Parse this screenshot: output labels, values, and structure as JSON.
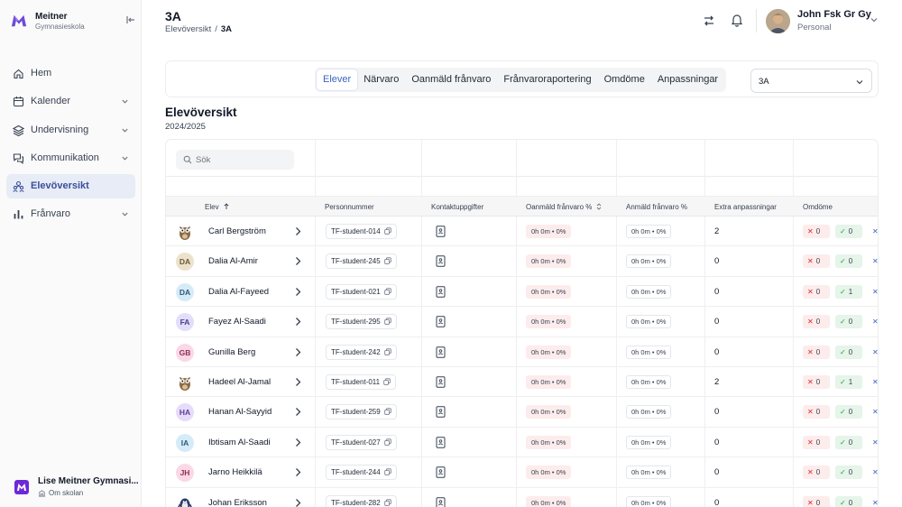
{
  "brand": {
    "name": "Meitner",
    "sub": "Gymnasieskola"
  },
  "nav": [
    {
      "label": "Hem",
      "icon": "home-icon",
      "has_chevron": false,
      "active": false
    },
    {
      "label": "Kalender",
      "icon": "calendar-icon",
      "has_chevron": true,
      "active": false
    },
    {
      "label": "Undervisning",
      "icon": "layers-icon",
      "has_chevron": true,
      "active": false
    },
    {
      "label": "Kommunikation",
      "icon": "chat-icon",
      "has_chevron": true,
      "active": false
    },
    {
      "label": "Elevöversikt",
      "icon": "students-icon",
      "has_chevron": false,
      "active": true
    },
    {
      "label": "Frånvaro",
      "icon": "bar-chart-icon",
      "has_chevron": true,
      "active": false
    }
  ],
  "school": {
    "name": "Lise Meitner Gymnasi...",
    "link": "Om skolan"
  },
  "header": {
    "title": "3A",
    "breadcrumb": [
      "Elevöversikt",
      "3A"
    ],
    "breadcrumb_sep": "/",
    "user_name": "John Fsk Gr Gy",
    "user_role": "Personal"
  },
  "tabs": [
    {
      "label": "Elever",
      "active": true
    },
    {
      "label": "Närvaro",
      "active": false
    },
    {
      "label": "Oanmäld frånvaro",
      "active": false
    },
    {
      "label": "Frånvaroraportering",
      "active": false
    },
    {
      "label": "Omdöme",
      "active": false
    },
    {
      "label": "Anpassningar",
      "active": false
    }
  ],
  "class_select": {
    "value": "3A"
  },
  "section": {
    "title": "Elevöversikt",
    "subtitle": "2024/2025"
  },
  "search": {
    "placeholder": "Sök"
  },
  "columns": {
    "elev": "Elev",
    "personnummer": "Personnummer",
    "kontakt": "Kontaktuppgifter",
    "oanmald": "Oanmäld frånvaro %",
    "anmald": "Anmäld frånvaro %",
    "extra": "Extra anpassningar",
    "omdome": "Omdöme"
  },
  "colors": {
    "accent": "#3b63c4",
    "active_nav_bg": "#e7ecf6",
    "unreported_bg": "#fdecec",
    "approved_bg": "#e6f4ea"
  },
  "students": [
    {
      "name": "Carl Bergström",
      "initials": "",
      "avatar": "owl",
      "avatar_bg": "#ffffff",
      "avatar_fg": "#6b4f2b",
      "id": "TF-student-014",
      "unreported": "0h 0m • 0%",
      "reported": "0h 0m • 0%",
      "extra": "2",
      "om_x": "0",
      "om_c": "0",
      "om_p": "✕"
    },
    {
      "name": "Dalia Al-Amir",
      "initials": "DA",
      "avatar": "initials",
      "avatar_bg": "#ece2cc",
      "avatar_fg": "#6b5a32",
      "id": "TF-student-245",
      "unreported": "0h 0m • 0%",
      "reported": "0h 0m • 0%",
      "extra": "0",
      "om_x": "0",
      "om_c": "0",
      "om_p": "✕"
    },
    {
      "name": "Dalia Al-Fayeed",
      "initials": "DA",
      "avatar": "initials",
      "avatar_bg": "#d6ebf8",
      "avatar_fg": "#2b5a7a",
      "id": "TF-student-021",
      "unreported": "0h 0m • 0%",
      "reported": "0h 0m • 0%",
      "extra": "0",
      "om_x": "0",
      "om_c": "1",
      "om_p": "✕"
    },
    {
      "name": "Fayez Al-Saadi",
      "initials": "FA",
      "avatar": "initials",
      "avatar_bg": "#e2defa",
      "avatar_fg": "#4a3c8c",
      "id": "TF-student-295",
      "unreported": "0h 0m • 0%",
      "reported": "0h 0m • 0%",
      "extra": "0",
      "om_x": "0",
      "om_c": "0",
      "om_p": "✕"
    },
    {
      "name": "Gunilla Berg",
      "initials": "GB",
      "avatar": "initials",
      "avatar_bg": "#fbd8e6",
      "avatar_fg": "#8c2f55",
      "id": "TF-student-242",
      "unreported": "0h 0m • 0%",
      "reported": "0h 0m • 0%",
      "extra": "0",
      "om_x": "0",
      "om_c": "0",
      "om_p": "✕"
    },
    {
      "name": "Hadeel Al-Jamal",
      "initials": "",
      "avatar": "owl",
      "avatar_bg": "#ffffff",
      "avatar_fg": "#6b4f2b",
      "id": "TF-student-011",
      "unreported": "0h 0m • 0%",
      "reported": "0h 0m • 0%",
      "extra": "2",
      "om_x": "0",
      "om_c": "1",
      "om_p": "✕"
    },
    {
      "name": "Hanan Al-Sayyid",
      "initials": "HA",
      "avatar": "initials",
      "avatar_bg": "#e6dcfa",
      "avatar_fg": "#5b3c9c",
      "id": "TF-student-259",
      "unreported": "0h 0m • 0%",
      "reported": "0h 0m • 0%",
      "extra": "0",
      "om_x": "0",
      "om_c": "0",
      "om_p": "✕"
    },
    {
      "name": "Ibtisam Al-Saadi",
      "initials": "IA",
      "avatar": "initials",
      "avatar_bg": "#d6ebf8",
      "avatar_fg": "#2b5a7a",
      "id": "TF-student-027",
      "unreported": "0h 0m • 0%",
      "reported": "0h 0m • 0%",
      "extra": "0",
      "om_x": "0",
      "om_c": "0",
      "om_p": "✕"
    },
    {
      "name": "Jarno Heikkilä",
      "initials": "JH",
      "avatar": "initials",
      "avatar_bg": "#fbd8e6",
      "avatar_fg": "#8c2f55",
      "id": "TF-student-244",
      "unreported": "0h 0m • 0%",
      "reported": "0h 0m • 0%",
      "extra": "0",
      "om_x": "0",
      "om_c": "0",
      "om_p": "✕"
    },
    {
      "name": "Johan Eriksson",
      "initials": "",
      "avatar": "penguin",
      "avatar_bg": "#ffffff",
      "avatar_fg": "#2b3a6b",
      "id": "TF-student-282",
      "unreported": "0h 0m • 0%",
      "reported": "0h 0m • 0%",
      "extra": "0",
      "om_x": "0",
      "om_c": "0",
      "om_p": "✕"
    }
  ]
}
